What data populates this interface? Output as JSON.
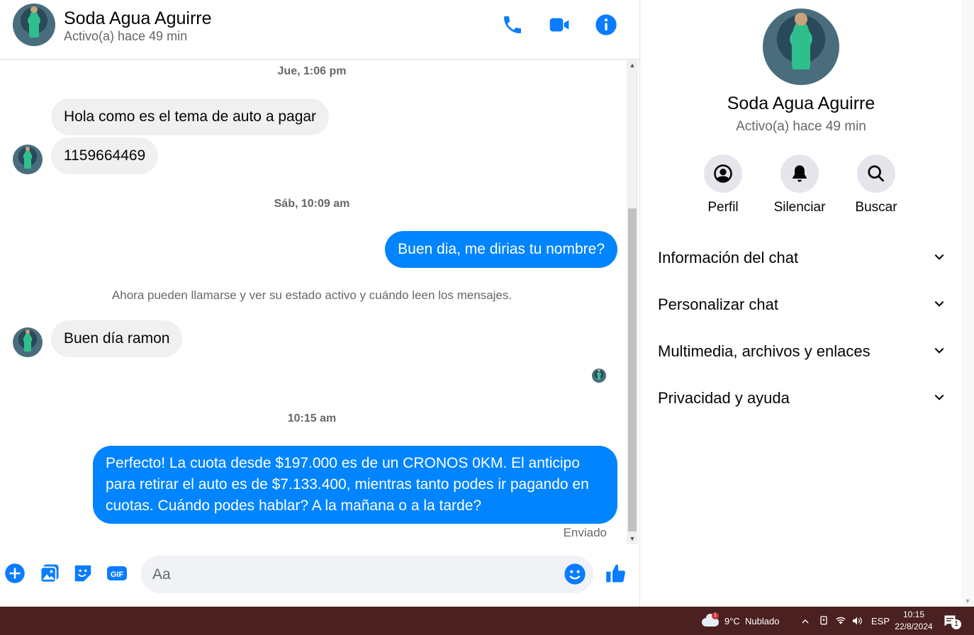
{
  "contact": {
    "name": "Soda Agua Aguirre",
    "status": "Activo(a) hace 49 min"
  },
  "header": {
    "icons": [
      "phone-icon",
      "video-icon",
      "info-icon"
    ]
  },
  "conversation": {
    "ts1": "Jue, 1:06 pm",
    "msg1": "Hola como es el tema de auto a pagar",
    "msg2": "1159664469",
    "ts2": "Sáb, 10:09 am",
    "msg3": "Buen dia, me dirias tu nombre?",
    "system": "Ahora pueden llamarse y ver su estado activo y cuándo leen los mensajes.",
    "msg4": "Buen día ramon",
    "ts3": "10:15 am",
    "msg5": "Perfecto! La cuota desde $197.000 es de un CRONOS 0KM. El anticipo para retirar el auto es de $7.133.400, mientras tanto podes ir pagando en cuotas. Cuándo podes hablar? A la mañana o a la tarde?",
    "sent": "Enviado"
  },
  "composer": {
    "placeholder": "Aa",
    "icons": [
      "plus-icon",
      "image-icon",
      "sticker-icon",
      "gif-icon",
      "emoji-icon",
      "like-icon"
    ],
    "gif_label": "GIF"
  },
  "info_panel": {
    "actions": {
      "profile": "Perfil",
      "mute": "Silenciar",
      "search": "Buscar"
    },
    "sections": {
      "chat_info": "Información del chat",
      "customize": "Personalizar chat",
      "media": "Multimedia, archivos y enlaces",
      "privacy": "Privacidad y ayuda"
    }
  },
  "taskbar": {
    "weather": "9°C  Nublado",
    "weather_badge": "1",
    "language": "ESP",
    "time": "10:15",
    "date": "22/8/2024",
    "notifications": "1"
  },
  "colors": {
    "accent": "#0a7cff",
    "outgoing_bubble": "#0084ff",
    "incoming_bubble": "#f0f0f0",
    "taskbar": "#4a2020"
  }
}
